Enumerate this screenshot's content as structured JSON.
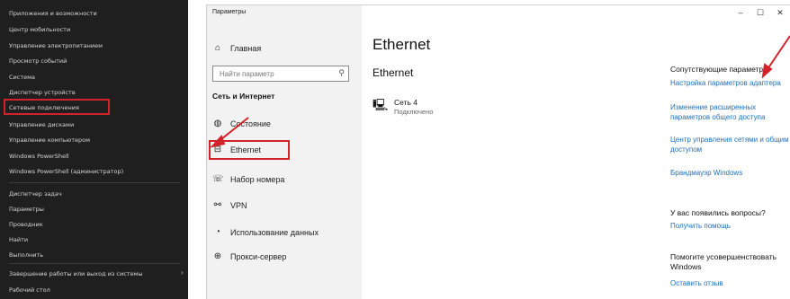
{
  "winx_menu": {
    "items": [
      "Приложения и возможности",
      "Центр мобильности",
      "Управление электропитанием",
      "Просмотр событий",
      "Система",
      "Диспетчер устройств",
      "Сетевые подключения",
      "Управление дисками",
      "Управление компьютером",
      "Windows PowerShell",
      "Windows PowerShell (администратор)",
      "Диспетчер задач",
      "Параметры",
      "Проводник",
      "Найти",
      "Выполнить",
      "Завершение работы или выход из системы",
      "Рабочий стол"
    ],
    "highlighted": "Сетевые подключения"
  },
  "settings": {
    "window_title": "Параметры",
    "controls": {
      "minimize": "–",
      "maximize": "☐",
      "close": "✕"
    },
    "sidebar": {
      "home": "Главная",
      "search_placeholder": "Найти параметр",
      "section": "Сеть и Интернет",
      "items": [
        "Состояние",
        "Ethernet",
        "Набор номера",
        "VPN",
        "Использование данных",
        "Прокси-сервер"
      ]
    },
    "main": {
      "title": "Ethernet",
      "section": "Ethernet",
      "network_name": "Сеть 4",
      "network_status": "Подключено"
    },
    "related": {
      "title": "Сопутствующие параметры",
      "links": [
        "Настройка параметров адаптера",
        "Изменение расширенных параметров общего доступа",
        "Центр управления сетями и общим доступом",
        "Брандмауэр Windows"
      ]
    },
    "questions": {
      "title": "У вас появились вопросы?",
      "link": "Получить помощь"
    },
    "improve": {
      "title": "Помогите усовершенствовать Windows",
      "link": "Оставить отзыв"
    }
  },
  "colors": {
    "annotation_red": "#d2232a",
    "link_blue": "#1f6fba",
    "menu_bg": "#1f1f1f"
  }
}
